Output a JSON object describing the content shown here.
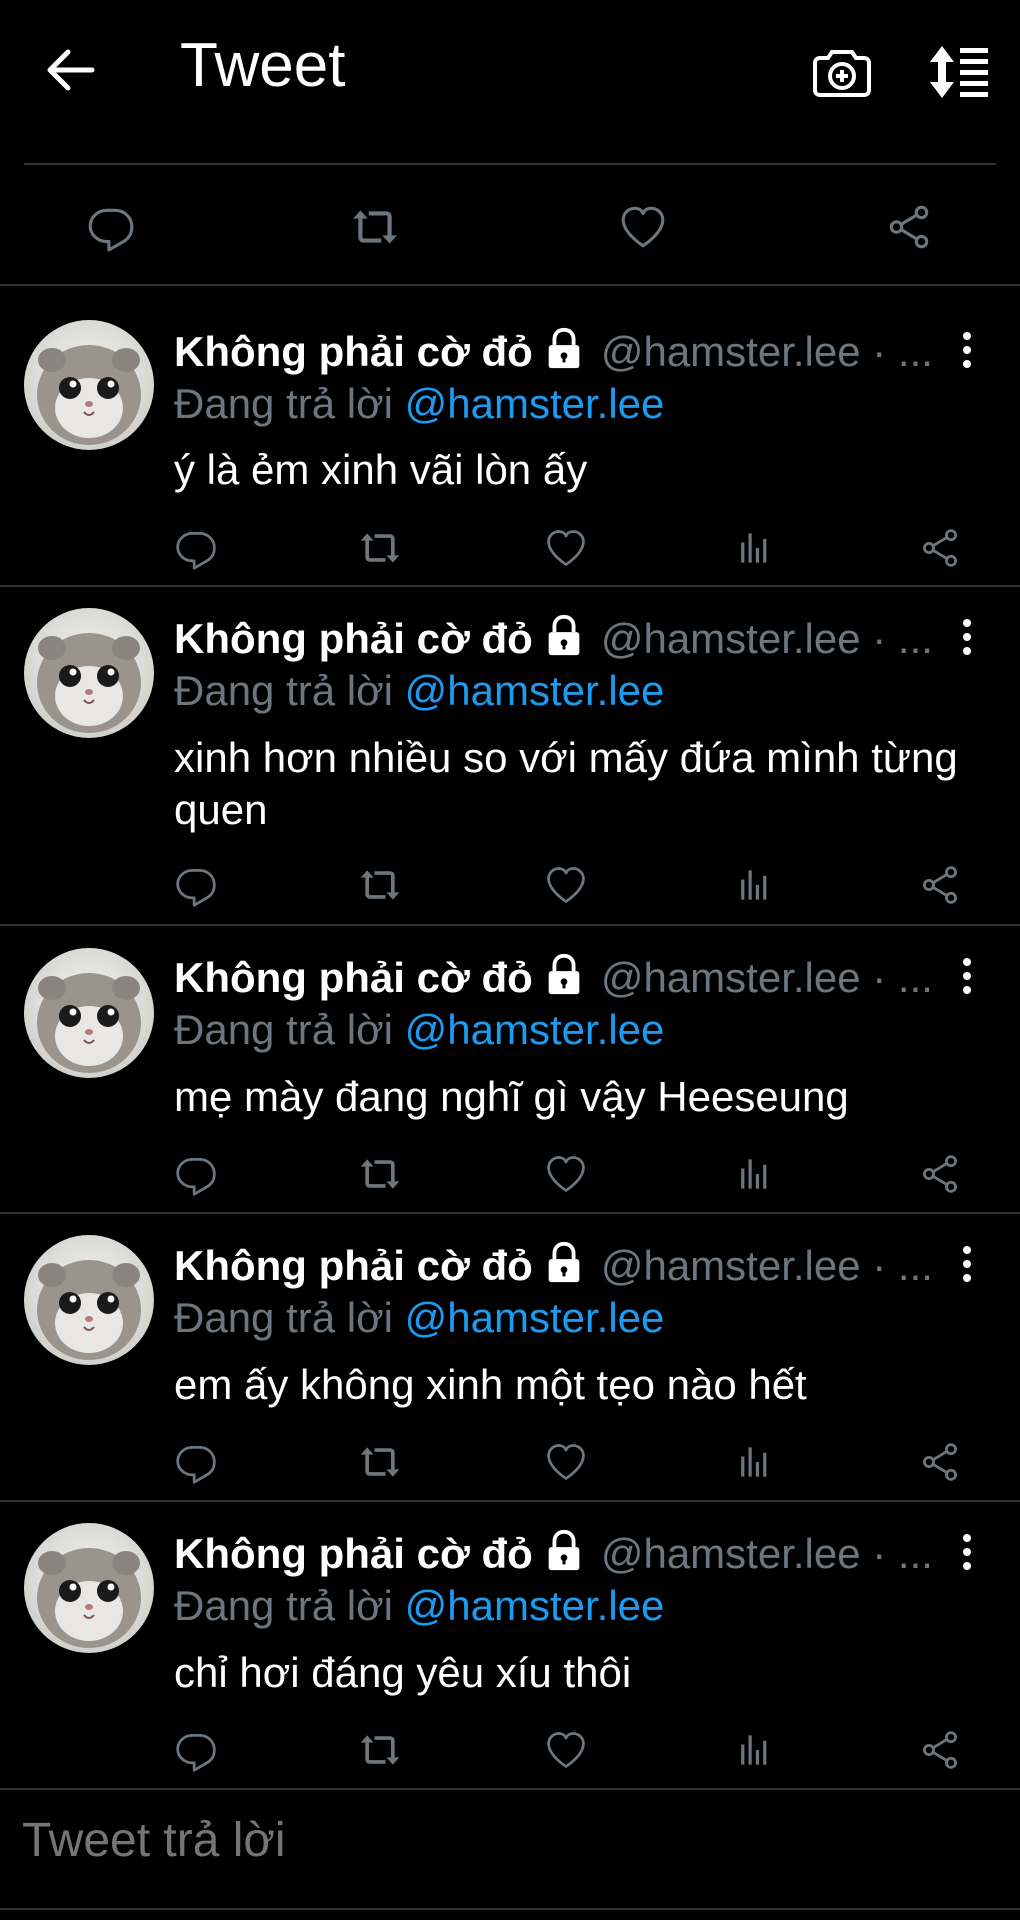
{
  "header": {
    "title": "Tweet",
    "back_icon": "arrow-left-icon",
    "camera_icon": "camera-plus-icon",
    "sort_icon": "sort-list-icon"
  },
  "colors": {
    "background": "#000000",
    "muted": "#6e767d",
    "accent": "#1d9bf0",
    "divider": "#2f3336"
  },
  "top_actions": [
    "reply-icon",
    "retweet-icon",
    "like-icon",
    "share-icon"
  ],
  "tweets": [
    {
      "name": "Không phải cờ đỏ",
      "handle": "@hamster.lee · ...",
      "replying_prefix": "Đang trả lời",
      "replying_to": "@hamster.lee",
      "text": "ý là ẻm xinh vãi lòn ấy"
    },
    {
      "name": "Không phải cờ đỏ",
      "handle": "@hamster.lee · ...",
      "replying_prefix": "Đang trả lời",
      "replying_to": "@hamster.lee",
      "text": "xinh hơn nhiều so với mấy đứa mình từng quen"
    },
    {
      "name": "Không phải cờ đỏ",
      "handle": "@hamster.lee · ...",
      "replying_prefix": "Đang trả lời",
      "replying_to": "@hamster.lee",
      "text": "mẹ mày đang nghĩ gì vậy Heeseung"
    },
    {
      "name": "Không phải cờ đỏ",
      "handle": "@hamster.lee · ...",
      "replying_prefix": "Đang trả lời",
      "replying_to": "@hamster.lee",
      "text": "em ấy không xinh một tẹo nào hết"
    },
    {
      "name": "Không phải cờ đỏ",
      "handle": "@hamster.lee · ...",
      "replying_prefix": "Đang trả lời",
      "replying_to": "@hamster.lee",
      "text": "chỉ hơi đáng yêu xíu thôi"
    }
  ],
  "reply": {
    "placeholder": "Tweet trả lời"
  }
}
